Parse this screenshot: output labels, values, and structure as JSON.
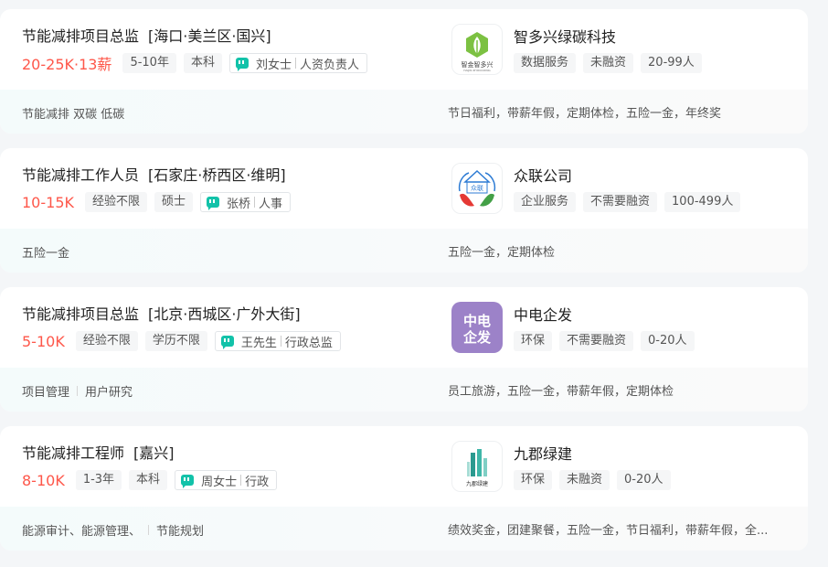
{
  "jobs": [
    {
      "title": "节能减排项目总监",
      "location": "[海口·美兰区·国兴]",
      "salary": "20-25K·13薪",
      "tags": [
        "5-10年",
        "本科"
      ],
      "recruiter_name": "刘女士",
      "recruiter_title": "人资负责人",
      "skills": [
        "节能减排 双碳 低碳"
      ],
      "welfare": "节日福利，带薪年假，定期体检，五险一金，年终奖",
      "company": {
        "name": "智多兴绿碳科技",
        "logo_text": "智金智多兴",
        "logo_sub": "HAIJIN ZHIDUOXING",
        "tags": [
          "数据服务",
          "未融资",
          "20-99人"
        ]
      }
    },
    {
      "title": "节能减排工作人员",
      "location": "[石家庄·桥西区·维明]",
      "salary": "10-15K",
      "tags": [
        "经验不限",
        "硕士"
      ],
      "recruiter_name": "张桥",
      "recruiter_title": "人事",
      "skills": [
        "五险一金"
      ],
      "welfare": "五险一金，定期体检",
      "company": {
        "name": "众联公司",
        "logo_text": "众联",
        "tags": [
          "企业服务",
          "不需要融资",
          "100-499人"
        ]
      }
    },
    {
      "title": "节能减排项目总监",
      "location": "[北京·西城区·广外大街]",
      "salary": "5-10K",
      "tags": [
        "经验不限",
        "学历不限"
      ],
      "recruiter_name": "王先生",
      "recruiter_title": "行政总监",
      "skills": [
        "项目管理",
        "用户研究"
      ],
      "welfare": "员工旅游，五险一金，带薪年假，定期体检",
      "company": {
        "name": "中电企发",
        "logo_text": "中电企发",
        "tags": [
          "环保",
          "不需要融资",
          "0-20人"
        ]
      }
    },
    {
      "title": "节能减排工程师",
      "location": "[嘉兴]",
      "salary": "8-10K",
      "tags": [
        "1-3年",
        "本科"
      ],
      "recruiter_name": "周女士",
      "recruiter_title": "行政",
      "skills": [
        "能源审计、能源管理、",
        "节能规划"
      ],
      "welfare": "绩效奖金，团建聚餐，五险一金，节日福利，带薪年假，全...",
      "company": {
        "name": "九郡绿建",
        "logo_text": "九郡绿建",
        "tags": [
          "环保",
          "未融资",
          "0-20人"
        ]
      }
    }
  ],
  "colors": {
    "salary": "#fe574a",
    "accent": "#12c2a9",
    "background": "#f4f6f8"
  }
}
